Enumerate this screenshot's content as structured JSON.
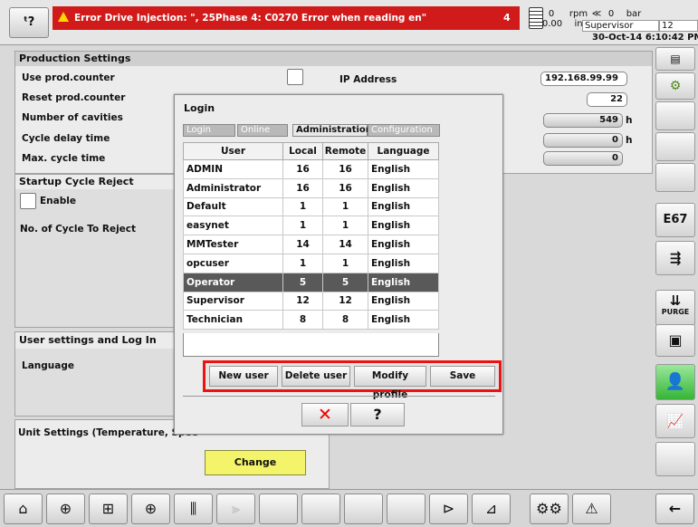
{
  "topbar": {
    "corner_button": "ᵗ?",
    "alarm_text": "Error Drive Injection: \", 25Phase 4: C0270 Error when reading en\"",
    "alarm_count": "4",
    "stat1_value": "0",
    "stat1_value2": "0.00",
    "stat2_value": "0",
    "stat2_unit_a": "rpm",
    "stat2_unit_b": "in",
    "stat3_value": "0",
    "stat3_unit": "bar",
    "user_role": "Supervisor",
    "role_extra": "12",
    "datetime": "30-Oct-14 6:10:42 PM"
  },
  "production": {
    "header": "Production Settings",
    "use_counter": "Use prod.counter",
    "reset_counter": "Reset prod.counter",
    "cavities": "Number of cavities",
    "cycle_delay": "Cycle delay time",
    "max_cycle": "Max. cycle time",
    "ip_label": "IP Address",
    "ip_value": "192.168.99.99",
    "cavities_value": "22",
    "cycle_delay_value": "549",
    "cycle_delay_unit": "h",
    "max_cycle_value": "0",
    "max_cycle_unit": "h",
    "extra_value": "0"
  },
  "startup": {
    "header": "Startup Cycle Reject",
    "enable": "Enable",
    "no_cycles": "No. of Cycle To Reject"
  },
  "user_settings": {
    "header": "User settings and Log In",
    "language": "Language"
  },
  "units": {
    "header": "Unit Settings (Temperature, Spee",
    "change_button": "Change"
  },
  "dialog": {
    "title": "Login",
    "tabs": [
      "Login",
      "Online",
      "Administration",
      "Configuration"
    ],
    "columns": [
      "User",
      "Local",
      "Remote",
      "Language"
    ],
    "rows": [
      {
        "user": "ADMIN",
        "local": "16",
        "remote": "16",
        "language": "English"
      },
      {
        "user": "Administrator",
        "local": "16",
        "remote": "16",
        "language": "English"
      },
      {
        "user": "Default",
        "local": "1",
        "remote": "1",
        "language": "English"
      },
      {
        "user": "easynet",
        "local": "1",
        "remote": "1",
        "language": "English"
      },
      {
        "user": "MMTester",
        "local": "14",
        "remote": "14",
        "language": "English"
      },
      {
        "user": "opcuser",
        "local": "1",
        "remote": "1",
        "language": "English"
      },
      {
        "user": "Operator",
        "local": "5",
        "remote": "5",
        "language": "English"
      },
      {
        "user": "Supervisor",
        "local": "12",
        "remote": "12",
        "language": "English"
      },
      {
        "user": "Technician",
        "local": "8",
        "remote": "8",
        "language": "English"
      }
    ],
    "buttons": {
      "new_user": "New user",
      "delete_user": "Delete user",
      "modify_profile": "Modify profile",
      "save": "Save",
      "cancel": "✕",
      "help": "?"
    }
  },
  "sidebar": {
    "e67": "E67",
    "purge": "PURGE"
  },
  "colors": {
    "alarm_red": "#d11b1b",
    "highlight_red": "#ee1111",
    "change_yellow": "#f4f46a",
    "selected_row": "#595959"
  }
}
